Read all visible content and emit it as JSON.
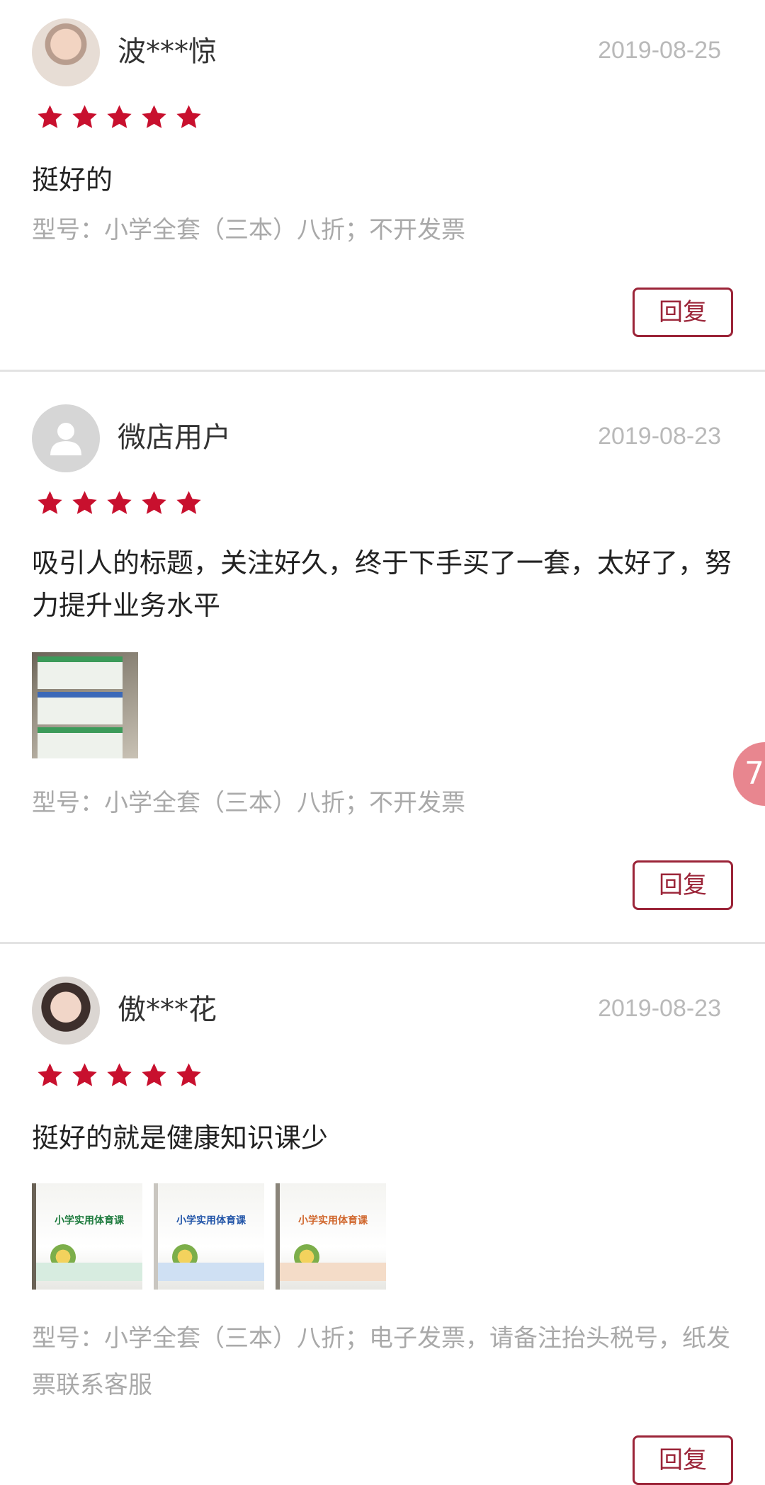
{
  "reviews": [
    {
      "username": "波***惊",
      "date": "2019-08-25",
      "rating": 5,
      "content": "挺好的",
      "variant": "型号：小学全套（三本）八折；不开发票",
      "reply_label": "回复",
      "avatar_type": "photo"
    },
    {
      "username": "微店用户",
      "date": "2019-08-23",
      "rating": 5,
      "content": "吸引人的标题，关注好久，终于下手买了一套，太好了，努力提升业务水平",
      "variant": "型号：小学全套（三本）八折；不开发票",
      "reply_label": "回复",
      "avatar_type": "default-user-icon",
      "photos": 1
    },
    {
      "username": "傲***花",
      "date": "2019-08-23",
      "rating": 5,
      "content": "挺好的就是健康知识课少",
      "variant": "型号：小学全套（三本）八折；电子发票，请备注抬头税号，纸发票联系客服",
      "reply_label": "回复",
      "avatar_type": "photo",
      "photos": 3,
      "photo_titles": [
        "小学实用体育课",
        "小学实用体育课",
        "小学实用体育课"
      ]
    }
  ],
  "floating_badge": "7",
  "colors": {
    "star": "#c8102e",
    "reply_border": "#9b2438",
    "date": "#b9b9b9",
    "variant": "#a9a9a9"
  }
}
